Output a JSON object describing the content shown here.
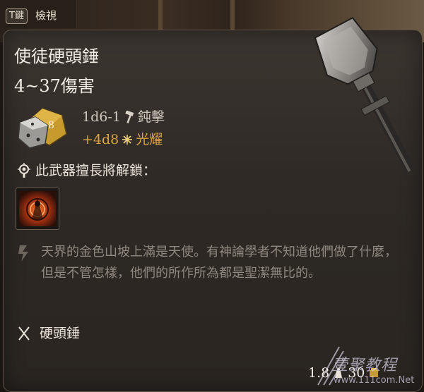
{
  "hint": {
    "key": "T鍵",
    "label": "檢視"
  },
  "item": {
    "name": "使徒硬頭錘",
    "damage_range": "4~37傷害",
    "rolls": [
      {
        "dice": "1d6-1",
        "type": "鈍擊",
        "icon": "blunt-damage-icon",
        "color": "#cfc8bd"
      },
      {
        "dice": "+4d8",
        "type": "光耀",
        "icon": "radiant-damage-icon",
        "color": "#d9a441"
      }
    ],
    "unlock_text": "此武器擅長將解鎖：",
    "ability_icon": "proficiency-ability-icon",
    "description": "天界的金色山坡上滿是天使。有神論學者不知道他們做了什麼，但是不管怎樣，他們的所作所為都是聖潔無比的。",
    "weapon_type": "硬頭錘",
    "weight": "1.8",
    "value": "30"
  },
  "watermark": {
    "brand": "壹聚教程",
    "url": "www.111com.Net"
  }
}
